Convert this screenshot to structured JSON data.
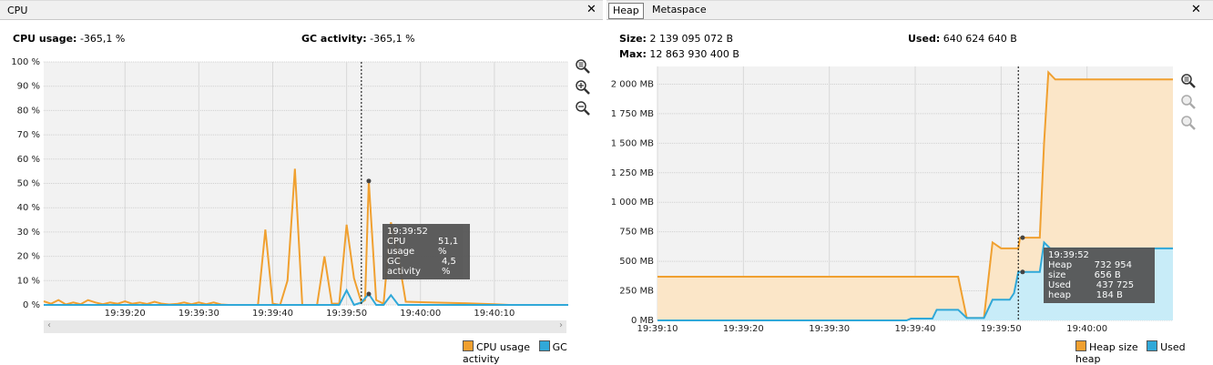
{
  "colors": {
    "cpu": "#f0a030",
    "gc": "#30a8d8",
    "heap": "#f0a030",
    "used": "#30a8d8",
    "plot_bg": "#f2f2f2"
  },
  "cpu": {
    "title": "CPU",
    "close_icon": "close-icon",
    "cpu_usage_label": "CPU usage:",
    "cpu_usage_value": "-365,1 %",
    "gc_activity_label": "GC activity:",
    "gc_activity_value": "-365,1 %",
    "zoom_icons": [
      "zoom-fit-icon",
      "zoom-in-icon",
      "zoom-out-icon"
    ],
    "tooltip": {
      "time": "19:39:52",
      "rows": [
        {
          "label": "CPU usage",
          "value": "51,1 %"
        },
        {
          "label": "GC activity",
          "value": "4,5 %"
        }
      ]
    },
    "legend": [
      "CPU usage",
      "GC activity"
    ],
    "chart_data": {
      "type": "line",
      "y_ticks": [
        "0 %",
        "10 %",
        "20 %",
        "30 %",
        "40 %",
        "50 %",
        "60 %",
        "70 %",
        "80 %",
        "90 %",
        "100 %"
      ],
      "x_ticks": [
        "19:39:20",
        "19:39:30",
        "19:39:40",
        "19:39:50",
        "19:40:00",
        "19:40:10"
      ],
      "ylim": [
        0,
        100
      ],
      "x_start_sec": 9,
      "x_end_sec": 80,
      "cursor_sec": 52,
      "series": [
        {
          "name": "CPU usage",
          "points": [
            [
              9,
              1.5
            ],
            [
              10,
              0.5
            ],
            [
              11,
              2
            ],
            [
              12,
              0.2
            ],
            [
              13,
              1
            ],
            [
              14,
              0.3
            ],
            [
              15,
              2
            ],
            [
              16,
              1
            ],
            [
              17,
              0.3
            ],
            [
              18,
              1
            ],
            [
              19,
              0.5
            ],
            [
              20,
              1.5
            ],
            [
              21,
              0.5
            ],
            [
              22,
              1
            ],
            [
              23,
              0.4
            ],
            [
              24,
              1.3
            ],
            [
              25,
              0.5
            ],
            [
              26,
              0.2
            ],
            [
              27,
              0.4
            ],
            [
              28,
              1
            ],
            [
              29,
              0.3
            ],
            [
              30,
              1
            ],
            [
              31,
              0.3
            ],
            [
              32,
              1
            ],
            [
              33,
              0.2
            ],
            [
              34,
              0
            ],
            [
              35,
              0
            ],
            [
              36,
              0
            ],
            [
              37,
              0
            ],
            [
              38,
              0
            ],
            [
              39,
              31
            ],
            [
              40,
              0.5
            ],
            [
              41,
              0
            ],
            [
              42,
              10
            ],
            [
              43,
              56
            ],
            [
              44,
              0
            ],
            [
              45,
              0
            ],
            [
              46,
              0
            ],
            [
              47,
              20
            ],
            [
              48,
              0.5
            ],
            [
              49,
              0.5
            ],
            [
              50,
              33
            ],
            [
              51,
              11
            ],
            [
              52,
              1
            ],
            [
              52.5,
              2
            ],
            [
              53,
              51
            ],
            [
              54,
              2
            ],
            [
              55,
              0.5
            ],
            [
              56,
              34
            ],
            [
              57,
              20
            ],
            [
              58,
              1.3
            ],
            [
              62,
              1
            ],
            [
              66,
              0.7
            ],
            [
              70,
              0.3
            ],
            [
              72,
              0
            ]
          ]
        },
        {
          "name": "GC activity",
          "points": [
            [
              9,
              0
            ],
            [
              47,
              0
            ],
            [
              48,
              0
            ],
            [
              49,
              0
            ],
            [
              50,
              6
            ],
            [
              51,
              0
            ],
            [
              52,
              1
            ],
            [
              53,
              4.5
            ],
            [
              54,
              0
            ],
            [
              55,
              0
            ],
            [
              56,
              4
            ],
            [
              57,
              0
            ],
            [
              80,
              0
            ]
          ]
        }
      ]
    }
  },
  "heap": {
    "tabs": [
      "Heap",
      "Metaspace"
    ],
    "close_icon": "close-icon",
    "size_label": "Size:",
    "size_value": "2 139 095 072 B",
    "used_label": "Used:",
    "used_value": "640 624 640 B",
    "max_label": "Max:",
    "max_value": "12 863 930 400 B",
    "zoom_icons": [
      "zoom-fit-icon",
      "zoom-in-icon",
      "zoom-out-icon"
    ],
    "tooltip": {
      "time": "19:39:52",
      "rows": [
        {
          "label": "Heap size",
          "value": "732 954 656 B"
        },
        {
          "label": "Used heap",
          "value": "437 725 184 B"
        }
      ]
    },
    "legend": [
      "Heap size",
      "Used heap"
    ],
    "chart_data": {
      "type": "area",
      "y_ticks": [
        "0 MB",
        "250 MB",
        "500 MB",
        "750 MB",
        "1 000 MB",
        "1 250 MB",
        "1 500 MB",
        "1 750 MB",
        "2 000 MB"
      ],
      "x_ticks": [
        "19:39:10",
        "19:39:20",
        "19:39:30",
        "19:39:40",
        "19:39:50",
        "19:40:00"
      ],
      "ylim": [
        0,
        2150
      ],
      "x_start_sec": 10,
      "x_end_sec": 70,
      "cursor_sec": 52,
      "series": [
        {
          "name": "Heap size",
          "points": [
            [
              10,
              370
            ],
            [
              45,
              370
            ],
            [
              46,
              20
            ],
            [
              48,
              20
            ],
            [
              49,
              660
            ],
            [
              50,
              610
            ],
            [
              52,
              610
            ],
            [
              52.2,
              700
            ],
            [
              54.5,
              700
            ],
            [
              55,
              1500
            ],
            [
              55.5,
              2100
            ],
            [
              56.3,
              2040
            ],
            [
              70,
              2040
            ]
          ]
        },
        {
          "name": "Used heap",
          "points": [
            [
              10,
              0
            ],
            [
              39,
              0
            ],
            [
              39.5,
              15
            ],
            [
              42,
              15
            ],
            [
              42.5,
              90
            ],
            [
              45,
              90
            ],
            [
              46,
              20
            ],
            [
              48,
              20
            ],
            [
              49,
              175
            ],
            [
              51,
              175
            ],
            [
              51.5,
              230
            ],
            [
              52,
              410
            ],
            [
              54.5,
              410
            ],
            [
              55,
              660
            ],
            [
              55.7,
              610
            ],
            [
              70,
              610
            ]
          ]
        }
      ]
    }
  }
}
